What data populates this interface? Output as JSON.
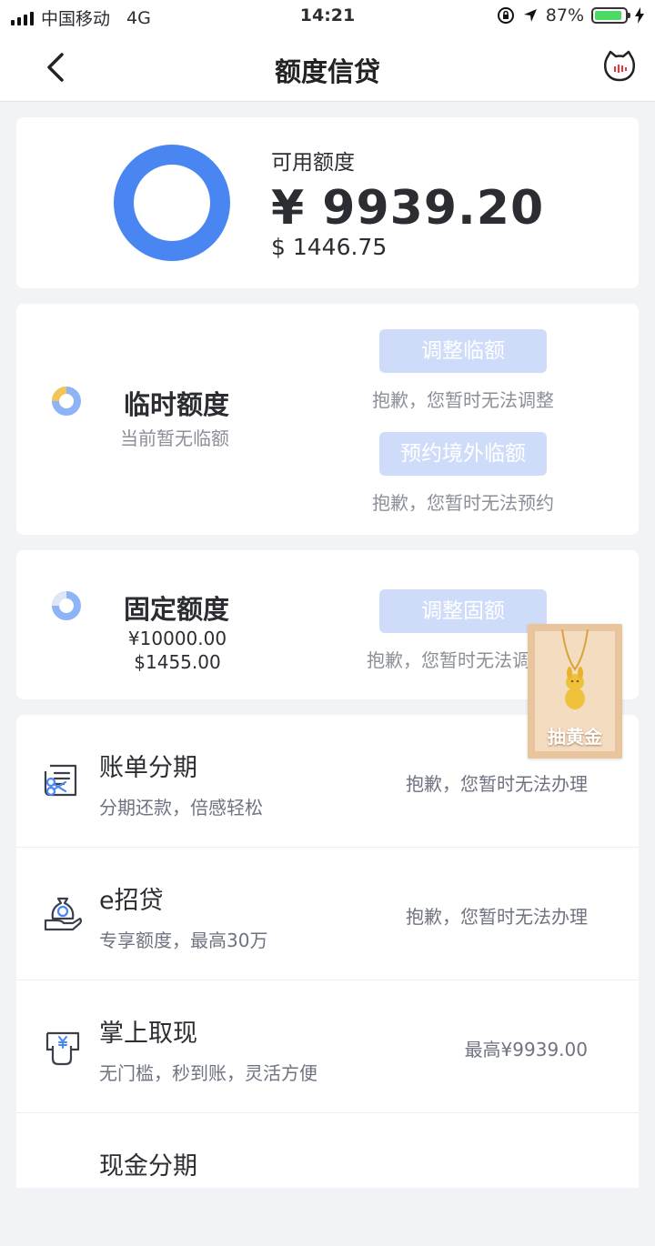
{
  "status_bar": {
    "carrier": "中国移动",
    "network": "4G",
    "time": "14:21",
    "battery": "87%",
    "battery_level": 0.87,
    "battery_color": "#4cd964"
  },
  "nav": {
    "title": "额度信贷",
    "back_icon": "chevron-left-icon",
    "service_icon": "cat-face-icon"
  },
  "available": {
    "label": "可用额度",
    "cny": "¥ 9939.20",
    "usd": "$ 1446.75",
    "ring_color": "#4a86f2"
  },
  "temporary": {
    "title": "临时额度",
    "subtitle": "当前暂无临额",
    "adjust_button": "调整临额",
    "adjust_note": "抱歉，您暂时无法调整",
    "overseas_button": "预约境外临额",
    "overseas_note": "抱歉，您暂时无法预约"
  },
  "fixed": {
    "title": "固定额度",
    "cny": "¥10000.00",
    "usd": "$1455.00",
    "adjust_button": "调整固额",
    "adjust_note": "抱歉，您暂时无法调"
  },
  "services": [
    {
      "title": "账单分期",
      "subtitle": "分期还款，倍感轻松",
      "status": "抱歉，您暂时无法办理",
      "icon": "bill-scissors-icon"
    },
    {
      "title": "e招贷",
      "subtitle": "专享额度，最高30万",
      "status": "抱歉，您暂时无法办理",
      "icon": "money-bag-hand-icon"
    },
    {
      "title": "掌上取现",
      "subtitle": "无门槛，秒到账，灵活方便",
      "status": "最高¥9939.00",
      "icon": "cash-withdraw-icon"
    },
    {
      "title": "现金分期",
      "subtitle": "",
      "status": "",
      "icon": ""
    }
  ],
  "promo": {
    "label": "抽黄金",
    "icon": "gold-pendant-icon"
  },
  "colors": {
    "accent": "#4a86f2",
    "pill": "#cfdcf9",
    "gold": "#e5b03a"
  }
}
